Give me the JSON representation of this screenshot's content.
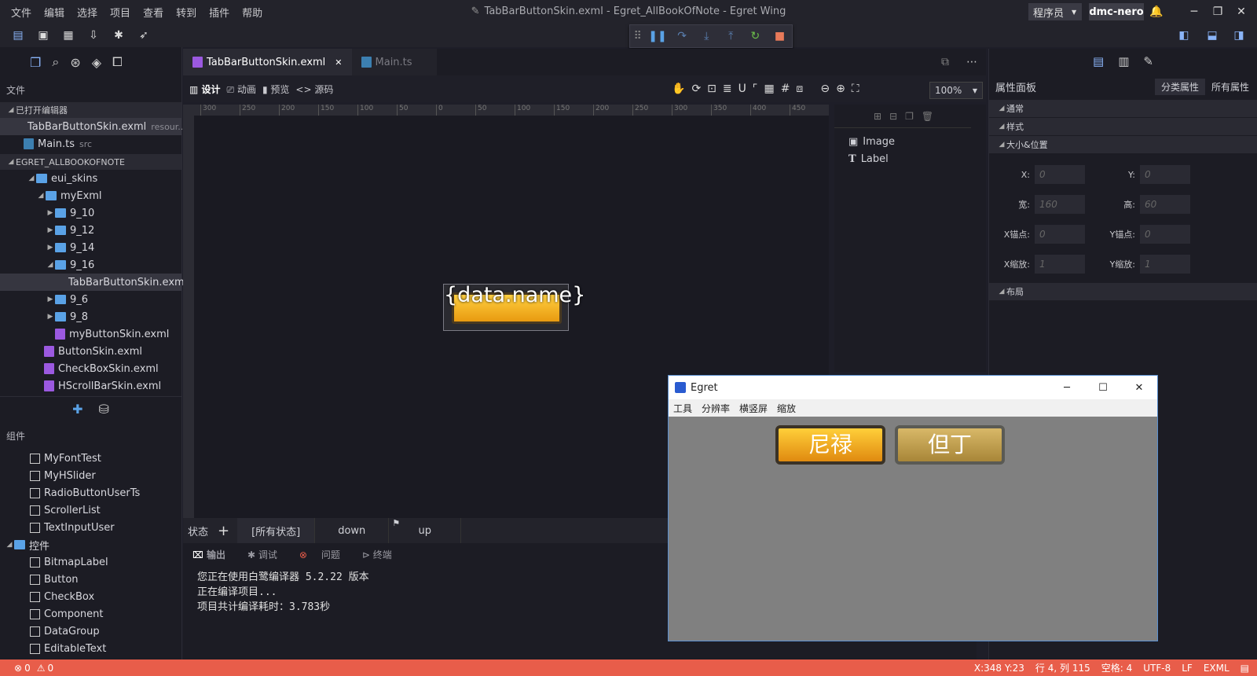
{
  "menu": [
    "文件",
    "编辑",
    "选择",
    "项目",
    "查看",
    "转到",
    "插件",
    "帮助"
  ],
  "window_title": "TabBarButtonSkin.exml - Egret_AllBookOfNote - Egret Wing",
  "role": "程序员",
  "role_arrow": "▼",
  "user": "dmc-nero",
  "window_controls": {
    "minimize": "─",
    "restore": "❐",
    "close": "✕"
  },
  "explorer": {
    "header": "文件",
    "open_editors_label": "已打开编辑器",
    "open_editors": [
      {
        "name": "TabBarButtonSkin.exml",
        "hint": "resour..."
      },
      {
        "name": "Main.ts",
        "hint": "src"
      }
    ],
    "project_label": "EGRET_ALLBOOKOFNOTE",
    "tree": [
      {
        "name": "eui_skins",
        "type": "folder",
        "arrow": "◢"
      },
      {
        "name": "myExml",
        "type": "folder",
        "arrow": "◢"
      },
      {
        "name": "9_10",
        "type": "folder",
        "arrow": "▶"
      },
      {
        "name": "9_12",
        "type": "folder",
        "arrow": "▶"
      },
      {
        "name": "9_14",
        "type": "folder",
        "arrow": "▶"
      },
      {
        "name": "9_16",
        "type": "folder",
        "arrow": "◢"
      },
      {
        "name": "TabBarButtonSkin.exml",
        "type": "exml"
      },
      {
        "name": "9_6",
        "type": "folder",
        "arrow": "▶"
      },
      {
        "name": "9_8",
        "type": "folder",
        "arrow": "▶"
      },
      {
        "name": "myButtonSkin.exml",
        "type": "exml"
      },
      {
        "name": "ButtonSkin.exml",
        "type": "exml"
      },
      {
        "name": "CheckBoxSkin.exml",
        "type": "exml"
      },
      {
        "name": "HScrollBarSkin.exml",
        "type": "exml"
      }
    ]
  },
  "components": {
    "header": "组件",
    "custom": [
      "MyFontTest",
      "MyHSlider",
      "RadioButtonUserTs",
      "ScrollerList",
      "TextInputUser"
    ],
    "controls_label": "控件",
    "controls": [
      "BitmapLabel",
      "Button",
      "CheckBox",
      "Component",
      "DataGroup",
      "EditableText"
    ]
  },
  "tabs": [
    {
      "label": "TabBarButtonSkin.exml",
      "close": "✕"
    },
    {
      "label": "Main.ts"
    }
  ],
  "design_modes": [
    "设计",
    "动画",
    "预览",
    "源码"
  ],
  "zoom": "100%",
  "ruler_top": [
    "300",
    "250",
    "200",
    "150",
    "100",
    "50",
    "0",
    "50",
    "100",
    "150",
    "200",
    "250",
    "300",
    "350",
    "400",
    "450"
  ],
  "canvas_button_text": "{data.name}",
  "outline": [
    "Image",
    "Label"
  ],
  "states": {
    "label": "状态",
    "add": "+",
    "items": [
      "[所有状态]",
      "down",
      "up"
    ]
  },
  "output": {
    "tabs": [
      "输出",
      "调试",
      "问题",
      "终端"
    ],
    "lines": [
      "您正在使用白鹭编译器 5.2.22 版本",
      "正在编译项目...",
      "项目共计编译耗时：3.783秒"
    ]
  },
  "properties": {
    "title": "属性面板",
    "tab_category": "分类属性",
    "tab_all": "所有属性",
    "groups": [
      "通常",
      "样式",
      "大小&位置",
      "布局"
    ],
    "fields": [
      {
        "label": "X:",
        "value": "0"
      },
      {
        "label": "Y:",
        "value": "0"
      },
      {
        "label": "宽:",
        "value": "160"
      },
      {
        "label": "高:",
        "value": "60"
      },
      {
        "label": "X锚点:",
        "value": "0"
      },
      {
        "label": "Y锚点:",
        "value": "0"
      },
      {
        "label": "X缩放:",
        "value": "1"
      },
      {
        "label": "Y缩放:",
        "value": "1"
      }
    ]
  },
  "egret_window": {
    "title": "Egret",
    "menu": [
      "工具",
      "分辨率",
      "横竖屏",
      "缩放"
    ],
    "buttons": [
      "尼禄",
      "但丁"
    ]
  },
  "statusbar": {
    "errors": "0",
    "warnings": "0",
    "coords": "X:348 Y:23",
    "cursor": "行 4, 列 115",
    "indent": "空格: 4",
    "encoding": "UTF-8",
    "eol": "LF",
    "lang": "EXML"
  }
}
